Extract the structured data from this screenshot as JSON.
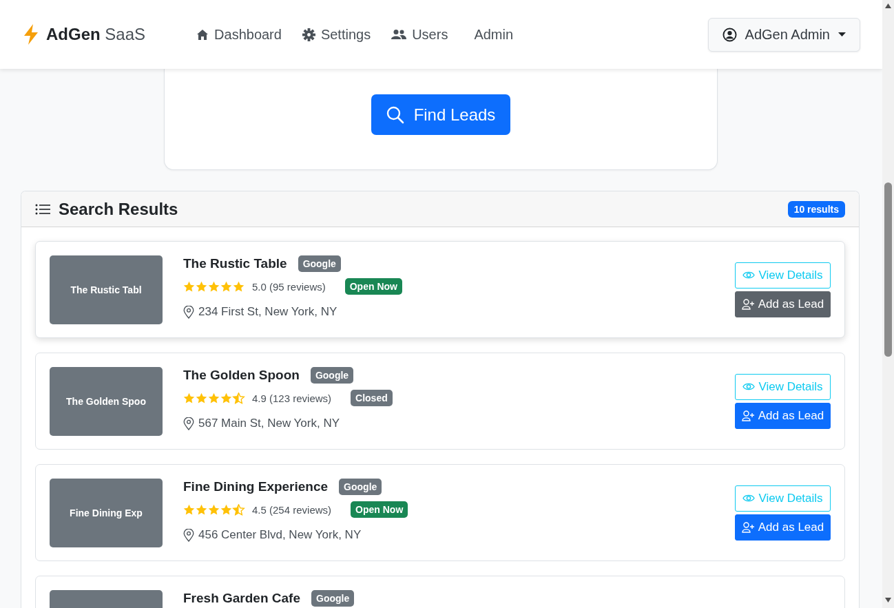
{
  "brand": {
    "name": "AdGen",
    "suffix": "SaaS"
  },
  "nav": [
    {
      "label": "Dashboard",
      "kind": "home"
    },
    {
      "label": "Settings",
      "kind": "settings"
    },
    {
      "label": "Users",
      "kind": "users"
    },
    {
      "label": "Admin",
      "kind": "plain"
    }
  ],
  "user_menu": {
    "label": "AdGen Admin"
  },
  "search": {
    "button": "Find Leads"
  },
  "results": {
    "title": "Search Results",
    "count": "10 results",
    "items": [
      {
        "thumb_text": "The Rustic Tabl",
        "name": "The Rustic Table",
        "source": "Google",
        "stars": 5,
        "rating": "5.0 (95 reviews)",
        "status": "Open Now",
        "open": true,
        "address": "234 First St, New York, NY",
        "view": "View Details",
        "add": "Add as Lead",
        "highlighted": true
      },
      {
        "thumb_text": "The Golden Spoo",
        "name": "The Golden Spoon",
        "source": "Google",
        "stars": 4.5,
        "rating": "4.9 (123 reviews)",
        "status": "Closed",
        "open": false,
        "address": "567 Main St, New York, NY",
        "view": "View Details",
        "add": "Add as Lead",
        "highlighted": false
      },
      {
        "thumb_text": "Fine Dining Exp",
        "name": "Fine Dining Experience",
        "source": "Google",
        "stars": 4.5,
        "rating": "4.5 (254 reviews)",
        "status": "Open Now",
        "open": true,
        "address": "456 Center Blvd, New York, NY",
        "view": "View Details",
        "add": "Add as Lead",
        "highlighted": false
      },
      {
        "name": "Fresh Garden Cafe",
        "source": "Google",
        "highlighted": false
      }
    ]
  }
}
